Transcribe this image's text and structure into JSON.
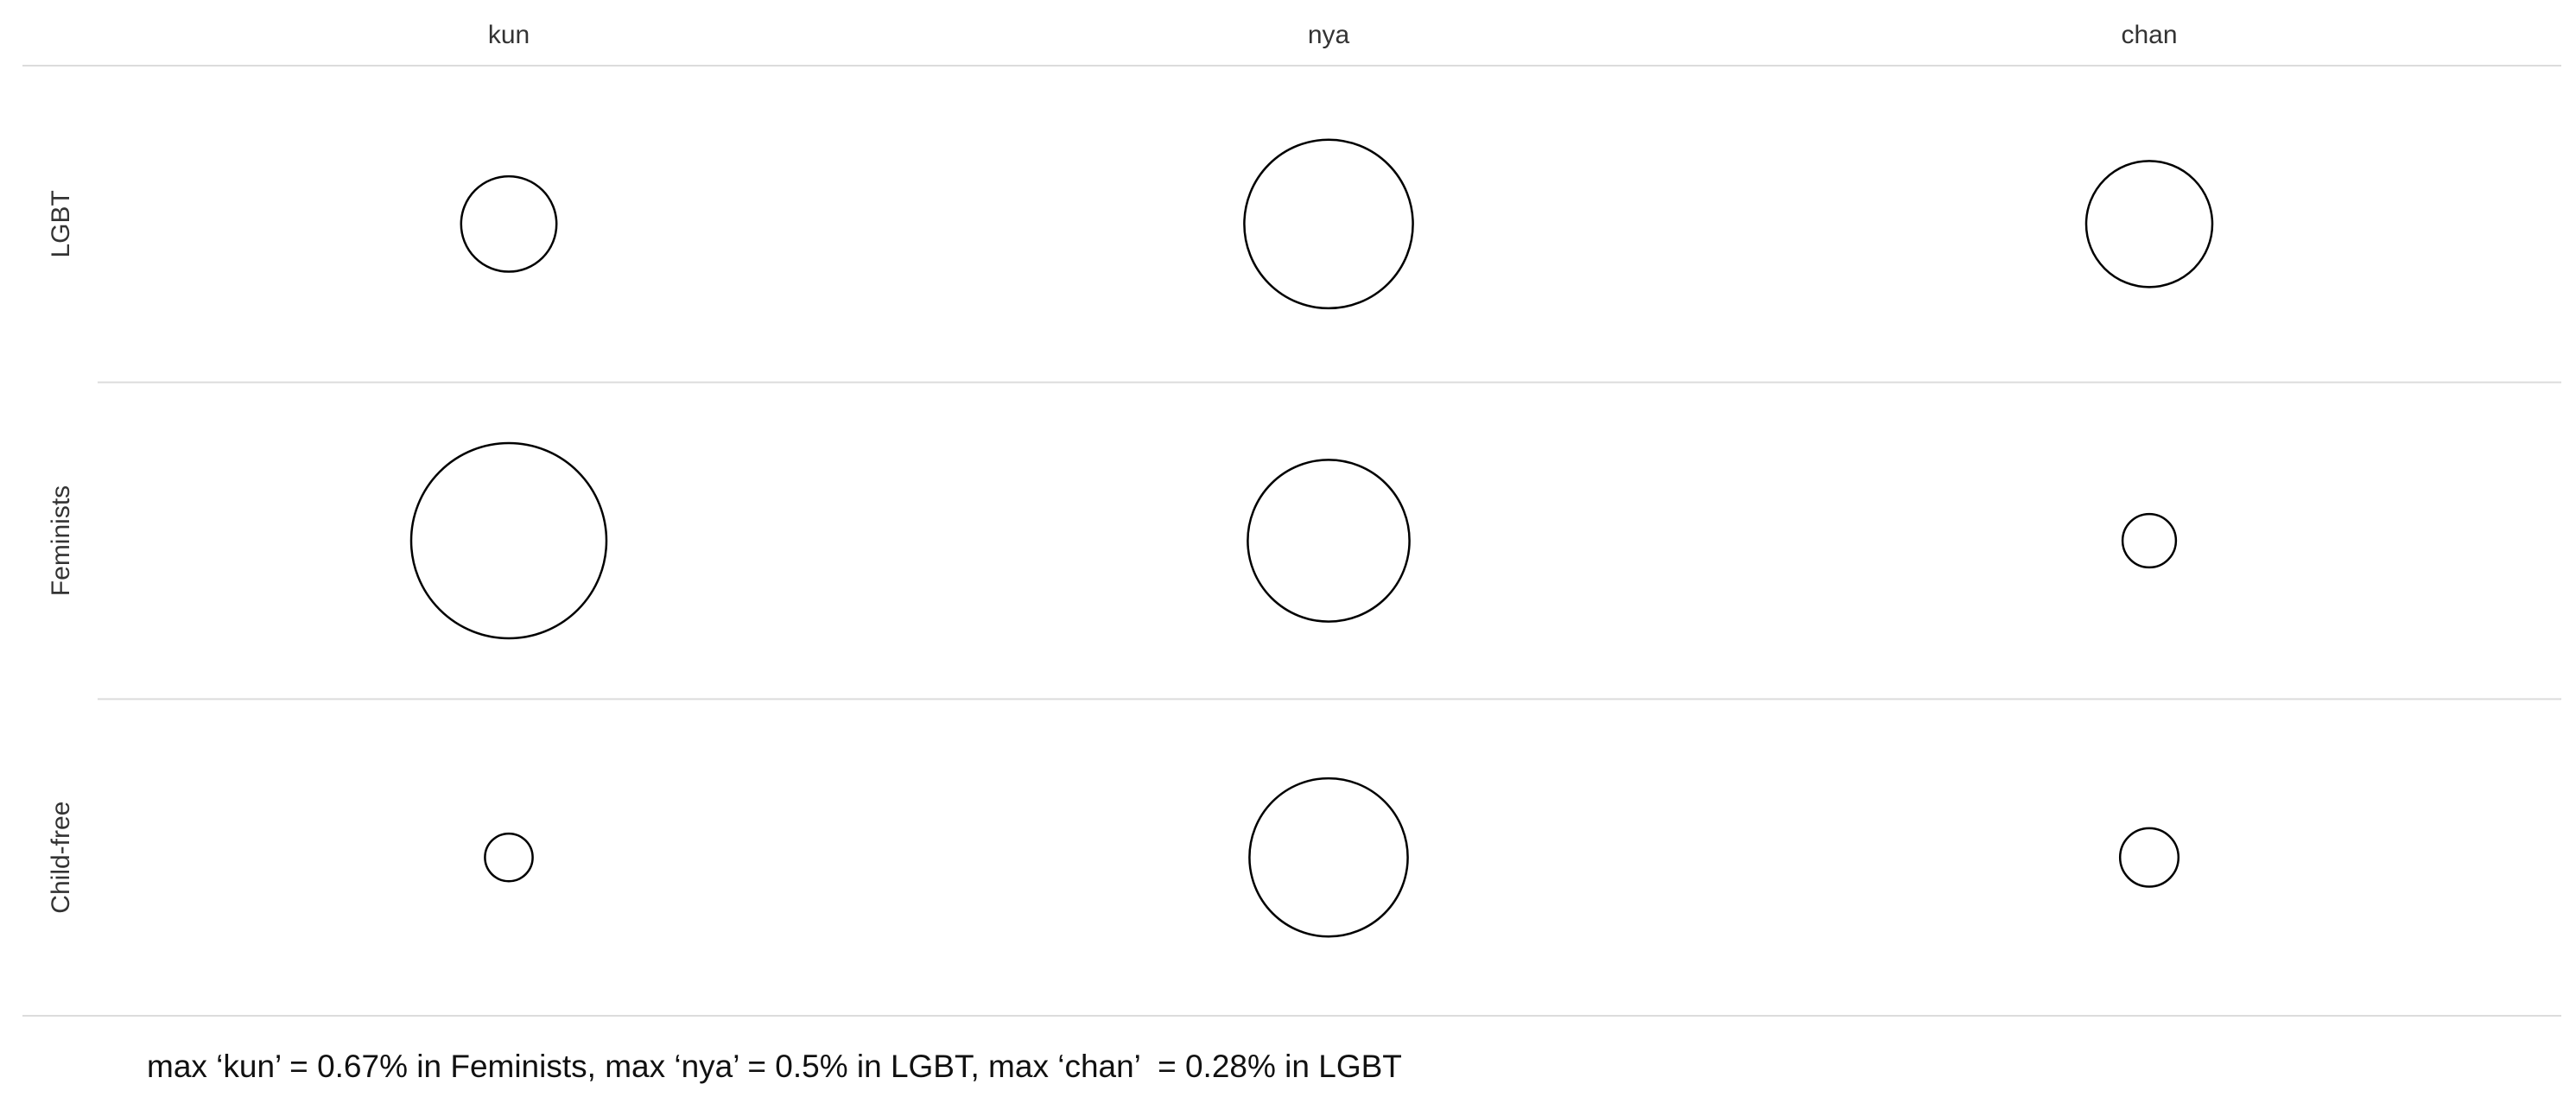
{
  "chart_data": {
    "type": "bubble-grid",
    "columns": [
      "kun",
      "nya",
      "chan"
    ],
    "rows": [
      "LGBT",
      "Feminists",
      "Child-free"
    ],
    "values": [
      [
        0.16,
        0.5,
        0.28
      ],
      [
        0.67,
        0.46,
        0.05
      ],
      [
        0.04,
        0.44,
        0.06
      ]
    ],
    "unit": "%",
    "max_per_column": [
      0.67,
      0.5,
      0.28
    ],
    "circle_color": "#000000",
    "grid_color": "#dcdcdc",
    "grid": true
  },
  "caption": "max ‘kun’ = 0.67% in Feminists, max ‘nya’ = 0.5% in LGBT, max ‘chan’  = 0.28% in LGBT"
}
